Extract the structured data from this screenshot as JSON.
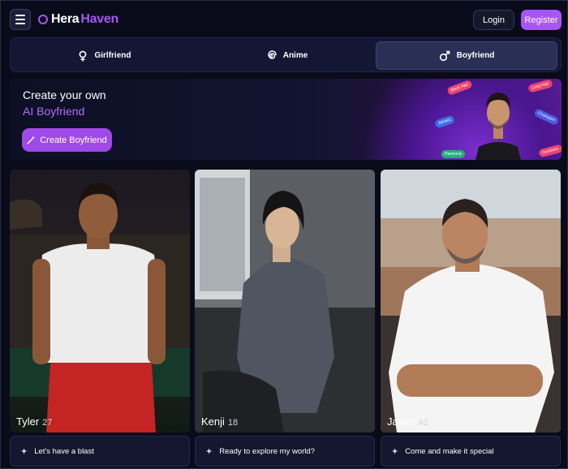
{
  "header": {
    "logo_part1": "Hera",
    "logo_part2": "Haven",
    "login_label": "Login",
    "register_label": "Register"
  },
  "tabs": [
    {
      "label": "Girlfriend",
      "icon": "female-icon",
      "active": false
    },
    {
      "label": "Anime",
      "icon": "spiral-icon",
      "active": false
    },
    {
      "label": "Boyfriend",
      "icon": "male-icon",
      "active": true
    }
  ],
  "hero": {
    "title_line1": "Create your own",
    "title_line2": "AI Boyfriend",
    "button_label": "Create Boyfriend",
    "pills": [
      "Athletic",
      "Black Hair",
      "Long Hair",
      "Champion",
      "Harmonic",
      "Outdoors"
    ]
  },
  "cards": [
    {
      "name": "Tyler",
      "age": "27",
      "tagline": "Let's have a blast"
    },
    {
      "name": "Kenji",
      "age": "18",
      "tagline": "Ready to explore my world?"
    },
    {
      "name": "Javier",
      "age": "42",
      "tagline": "Come and make it special"
    }
  ],
  "colors": {
    "accent": "#a855f7",
    "background": "#0a0b1a",
    "tab_bar": "#141733",
    "tab_active": "#2a2f55"
  }
}
